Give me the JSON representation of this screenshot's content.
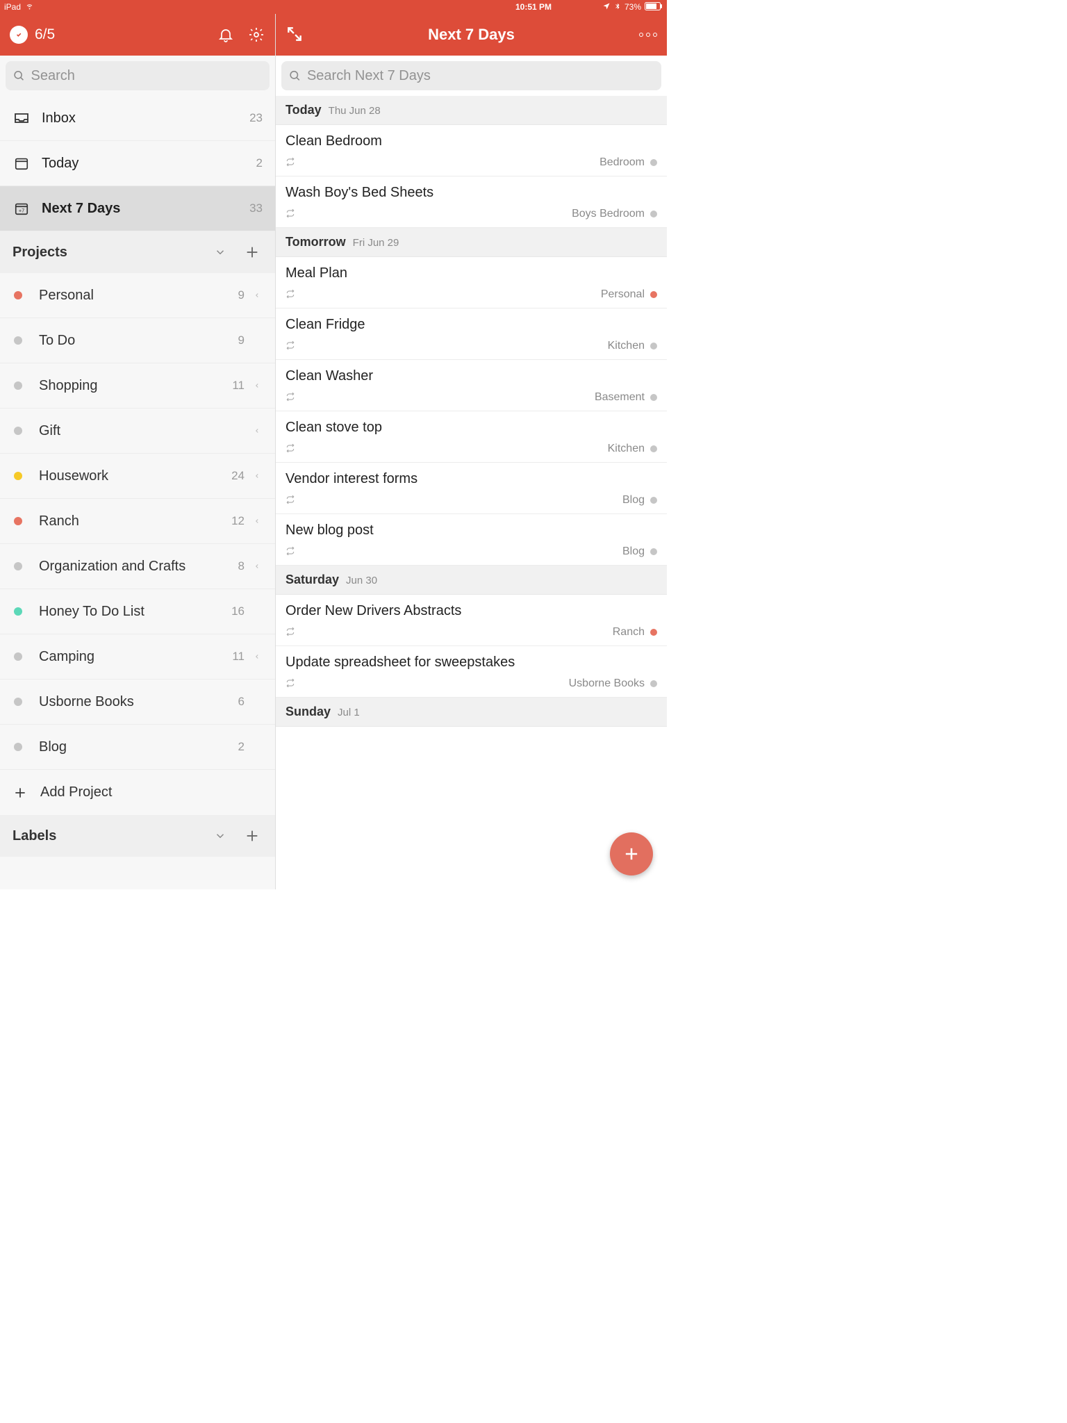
{
  "status": {
    "device": "iPad",
    "time": "10:51 PM",
    "battery": "73%"
  },
  "sidebar": {
    "karma": "6/5",
    "search_placeholder": "Search",
    "nav": [
      {
        "label": "Inbox",
        "count": "23"
      },
      {
        "label": "Today",
        "count": "2"
      },
      {
        "label": "Next 7 Days",
        "count": "33"
      }
    ],
    "projects_header": "Projects",
    "projects": [
      {
        "label": "Personal",
        "count": "9",
        "color": "#e77462",
        "chev": true
      },
      {
        "label": "To Do",
        "count": "9",
        "color": "#c6c6c6",
        "chev": false
      },
      {
        "label": "Shopping",
        "count": "11",
        "color": "#c6c6c6",
        "chev": true
      },
      {
        "label": "Gift",
        "count": "",
        "color": "#c6c6c6",
        "chev": true
      },
      {
        "label": "Housework",
        "count": "24",
        "color": "#f6c927",
        "chev": true
      },
      {
        "label": "Ranch",
        "count": "12",
        "color": "#e77462",
        "chev": true
      },
      {
        "label": "Organization and Crafts",
        "count": "8",
        "color": "#c6c6c6",
        "chev": true
      },
      {
        "label": "Honey To Do List",
        "count": "16",
        "color": "#5cd8b8",
        "chev": false
      },
      {
        "label": "Camping",
        "count": "11",
        "color": "#c6c6c6",
        "chev": true
      },
      {
        "label": "Usborne Books",
        "count": "6",
        "color": "#c6c6c6",
        "chev": false
      },
      {
        "label": "Blog",
        "count": "2",
        "color": "#c6c6c6",
        "chev": false
      }
    ],
    "add_project": "Add Project",
    "labels_header": "Labels"
  },
  "main": {
    "title": "Next 7 Days",
    "search_placeholder": "Search Next 7 Days",
    "groups": [
      {
        "name": "Today",
        "date": "Thu Jun 28",
        "tasks": [
          {
            "title": "Clean Bedroom",
            "project": "Bedroom",
            "pcolor": "#c6c6c6"
          },
          {
            "title": "Wash Boy's Bed Sheets",
            "project": "Boys Bedroom",
            "pcolor": "#c6c6c6"
          }
        ]
      },
      {
        "name": "Tomorrow",
        "date": "Fri Jun 29",
        "tasks": [
          {
            "title": "Meal Plan",
            "project": "Personal",
            "pcolor": "#e77462"
          },
          {
            "title": "Clean Fridge",
            "project": "Kitchen",
            "pcolor": "#c6c6c6"
          },
          {
            "title": "Clean Washer",
            "project": "Basement",
            "pcolor": "#c6c6c6"
          },
          {
            "title": "Clean stove top",
            "project": "Kitchen",
            "pcolor": "#c6c6c6"
          },
          {
            "title": "Vendor interest forms",
            "project": "Blog",
            "pcolor": "#c6c6c6"
          },
          {
            "title": "New blog post",
            "project": "Blog",
            "pcolor": "#c6c6c6"
          }
        ]
      },
      {
        "name": "Saturday",
        "date": "Jun 30",
        "tasks": [
          {
            "title": "Order New Drivers Abstracts",
            "project": "Ranch",
            "pcolor": "#e77462"
          },
          {
            "title": "Update spreadsheet for sweepstakes",
            "project": "Usborne Books",
            "pcolor": "#c6c6c6"
          }
        ]
      },
      {
        "name": "Sunday",
        "date": "Jul 1",
        "tasks": []
      }
    ]
  }
}
